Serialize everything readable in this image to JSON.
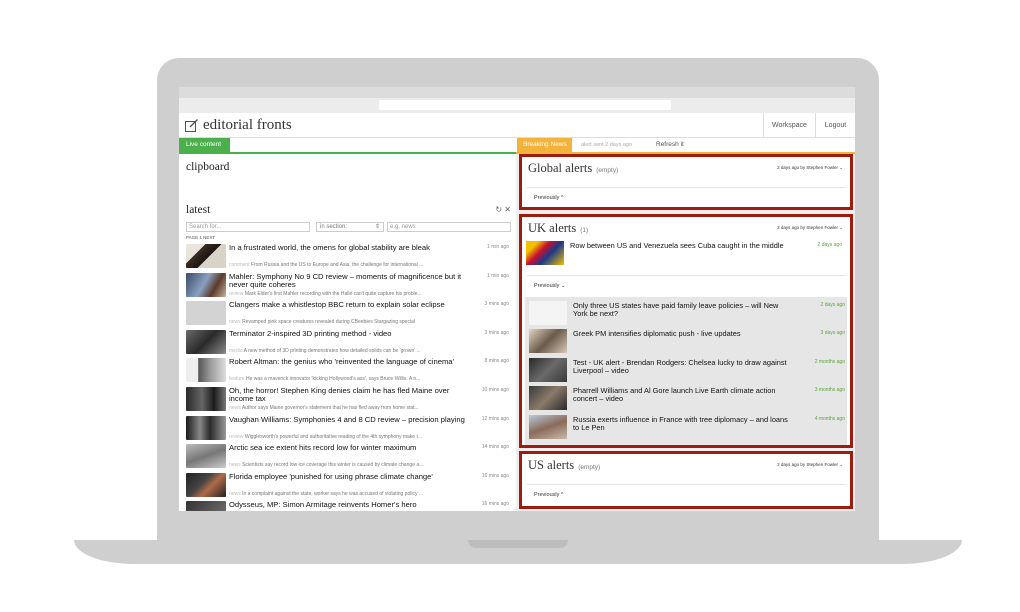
{
  "app": {
    "title": "editorial fronts",
    "workspace_label": "Workspace",
    "logout_label": "Logout"
  },
  "left": {
    "live_tab": "Live content",
    "clipboard_title": "clipboard",
    "latest_title": "latest",
    "search_placeholder": "Search for...",
    "section_value": "in section:",
    "eg_placeholder": "e.g. news",
    "page_label": "PAGE 1 NEXT",
    "items": [
      {
        "title": "In a frustrated world, the omens for global stability are bleak",
        "tag": "comment",
        "sub": "From Russia and the US to Europe and Asia, the challenge for international ...",
        "time": "1 min ago"
      },
      {
        "title": "Mahler: Symphony No 9 CD review – moments of magnificence but it never quite coheres",
        "tag": "review",
        "sub": "Mark Elder's first Mahler recording with the Hallé can't quite capture his proble...",
        "time": "1 min ago"
      },
      {
        "title": "Clangers make a whistlestop BBC return to explain solar eclipse",
        "tag": "news",
        "sub": "Revamped pink space creatures revealed during CBeebies Stargazing special",
        "time": "3 mins ago"
      },
      {
        "title": "Terminator 2-inspired 3D printing method - video",
        "tag": "media",
        "sub": "A new method of 3D printing demonstrates how detailed solids can be 'grown' ...",
        "time": "3 mins ago"
      },
      {
        "title": "Robert Altman: the genius who 'reinvented the language of cinema'",
        "tag": "feature",
        "sub": "He was a maverick innovator 'kicking Hollywood's ass', says Bruce Willis. A n...",
        "time": "8 mins ago"
      },
      {
        "title": "Oh, the horror! Stephen King denies claim he has fled Maine over income tax",
        "tag": "news",
        "sub": "Author says Maine governor's statement that he has fled away from home stat...",
        "time": "10 mins ago"
      },
      {
        "title": "Vaughan Williams: Symphonies 4 and 8 CD review – precision playing",
        "tag": "review",
        "sub": "Wigglesworth's powerful and authoritative reading of the 4th symphony make t...",
        "time": "12 mins ago"
      },
      {
        "title": "Arctic sea ice extent hits record low for winter maximum",
        "tag": "news",
        "sub": "Scientists say record low ice coverage this winter is caused by climate change a...",
        "time": "14 mins ago"
      },
      {
        "title": "Florida employee 'punished for using phrase climate change'",
        "tag": "news",
        "sub": "In a complaint against the state, worker says he was accused of violating policy ...",
        "time": "16 mins ago"
      },
      {
        "title": "Odysseus, MP: Simon Armitage reinvents Homer's hero",
        "tag": "",
        "sub": "",
        "time": "16 mins ago"
      }
    ]
  },
  "right": {
    "bn_tab": "Breaking News",
    "bn_sent": "alert sent 2 days ago",
    "refresh_label": "Refresh it",
    "global": {
      "title": "Global alerts",
      "count": "(empty)",
      "meta": "2 days ago by Stephen Fowler",
      "previously": "Previously ^"
    },
    "uk": {
      "title": "UK alerts",
      "count": "(1)",
      "meta": "2 days ago by Stephen Fowler",
      "previously": "Previously ⌄",
      "current": {
        "title": "Row between US and Venezuela sees Cuba caught in the middle",
        "time": "2 days ago"
      },
      "previous": [
        {
          "title": "Only three US states have paid family leave policies – will New York be next?",
          "time": "2 days ago"
        },
        {
          "title": "Greek PM intensifies diplomatic push - live updates",
          "time": "3 days ago"
        },
        {
          "title": "Test - UK alert - Brendan Rodgers: Chelsea lucky to draw against Liverpool – video",
          "time": "2 months ago"
        },
        {
          "title": "Pharrell Williams and Al Gore launch Live Earth climate action concert – video",
          "time": "3 months ago"
        },
        {
          "title": "Russia exerts influence in France with tree diplomacy – and loans to Le Pen",
          "time": "4 months ago"
        }
      ]
    },
    "us": {
      "title": "US alerts",
      "count": "(empty)",
      "meta": "2 days ago by Stephen Fowler",
      "previously": "Previously ^"
    }
  },
  "colors": {
    "live_green": "#4bb04b",
    "breaking_orange": "#f3b23a",
    "alert_border": "#9c1c10",
    "time_green": "#5aa53a"
  }
}
